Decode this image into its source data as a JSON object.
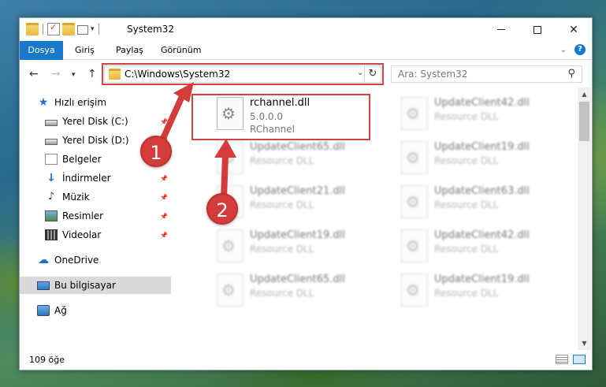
{
  "window": {
    "title": "System32"
  },
  "ribbon": {
    "tabs": [
      "Dosya",
      "Giriş",
      "Paylaş",
      "Görünüm"
    ],
    "help": "?"
  },
  "address": {
    "path": "C:\\Windows\\System32",
    "search_placeholder": "Ara: System32"
  },
  "sidebar": {
    "items": [
      {
        "label": "Hızlı erişim",
        "icon": "star-icon",
        "pinned": false
      },
      {
        "label": "Yerel Disk (C:)",
        "icon": "disk-icon",
        "pinned": true
      },
      {
        "label": "Yerel Disk (D:)",
        "icon": "disk-icon",
        "pinned": true
      },
      {
        "label": "Belgeler",
        "icon": "document-icon",
        "pinned": true
      },
      {
        "label": "İndirmeler",
        "icon": "download-icon",
        "pinned": true
      },
      {
        "label": "Müzik",
        "icon": "music-icon",
        "pinned": true
      },
      {
        "label": "Resimler",
        "icon": "pictures-icon",
        "pinned": true
      },
      {
        "label": "Videolar",
        "icon": "video-icon",
        "pinned": true
      },
      {
        "label": "OneDrive",
        "icon": "cloud-icon",
        "pinned": false
      },
      {
        "label": "Bu bilgisayar",
        "icon": "computer-icon",
        "pinned": false,
        "selected": true
      },
      {
        "label": "Ağ",
        "icon": "network-icon",
        "pinned": false
      }
    ]
  },
  "files": [
    {
      "name": "rchannel.dll",
      "line1": "5.0.0.0",
      "line2": "RChannel",
      "blurred": false
    },
    {
      "name": "UpdateClient42.dll",
      "line1": "Resource DLL",
      "blurred": true
    },
    {
      "name": "UpdateClient65.dll",
      "line1": "Resource DLL",
      "blurred": true
    },
    {
      "name": "UpdateClient19.dll",
      "line1": "Resource DLL",
      "blurred": true
    },
    {
      "name": "UpdateClient21.dll",
      "line1": "Resource DLL",
      "blurred": true
    },
    {
      "name": "UpdateClient63.dll",
      "line1": "Resource DLL",
      "blurred": true
    },
    {
      "name": "UpdateClient19.dll",
      "line1": "Resource DLL",
      "blurred": true
    },
    {
      "name": "UpdateClient42.dll",
      "line1": "Resource DLL",
      "blurred": true
    },
    {
      "name": "UpdateClient65.dll",
      "line1": "Resource DLL",
      "blurred": true
    },
    {
      "name": "UpdateClient19.dll",
      "line1": "Resource DLL",
      "blurred": true
    }
  ],
  "status": {
    "count": "109 öğe"
  },
  "annotations": {
    "badge1": "1",
    "badge2": "2",
    "color": "#d43c3c"
  }
}
